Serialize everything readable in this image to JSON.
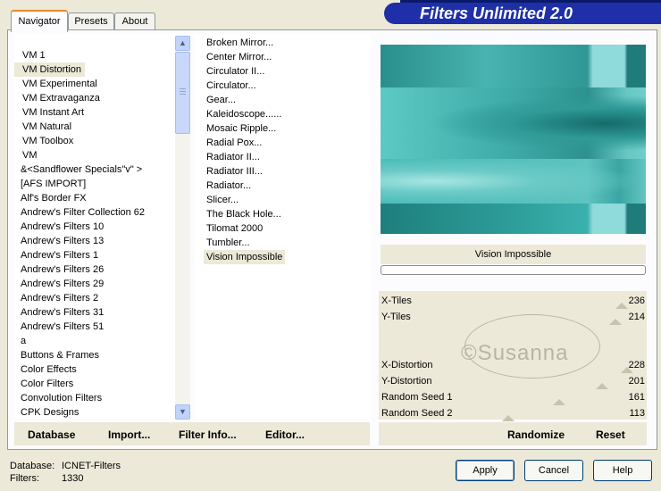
{
  "tabs": [
    "Navigator",
    "Presets",
    "About"
  ],
  "app_title": "Filters Unlimited 2.0",
  "categories": [
    "VM 1",
    "VM Distortion",
    "VM Experimental",
    "VM Extravaganza",
    "VM Instant Art",
    "VM Natural",
    "VM Toolbox",
    "VM",
    "&<Sandflower Specials\"v\" >",
    "[AFS IMPORT]",
    "Alf's Border FX",
    "Andrew's Filter Collection 62",
    "Andrew's Filters 10",
    "Andrew's Filters 13",
    "Andrew's Filters 1",
    "Andrew's Filters 26",
    "Andrew's Filters 29",
    "Andrew's Filters 2",
    "Andrew's Filters 31",
    "Andrew's Filters 51",
    "a",
    "Buttons & Frames",
    "Color Effects",
    "Color Filters",
    "Convolution Filters",
    "CPK Designs"
  ],
  "selected_category": "VM Distortion",
  "filters": [
    "Broken Mirror...",
    "Center Mirror...",
    "Circulator II...",
    "Circulator...",
    "Gear...",
    "Kaleidoscope......",
    "Mosaic Ripple...",
    "Radial Pox...",
    "Radiator II...",
    "Radiator III...",
    "Radiator...",
    "Slicer...",
    "The Black Hole...",
    "Tilomat 2000",
    "Tumbler...",
    "Vision Impossible"
  ],
  "selected_filter": "Vision Impossible",
  "nav_buttons": {
    "database": "Database",
    "import": "Import...",
    "filter_info": "Filter Info...",
    "editor": "Editor..."
  },
  "preview_title": "Vision Impossible",
  "params": [
    {
      "label": "X-Tiles",
      "value": "236"
    },
    {
      "label": "Y-Tiles",
      "value": "214"
    },
    {
      "label": "",
      "value": ""
    },
    {
      "label": "",
      "value": ""
    },
    {
      "label": "X-Distortion",
      "value": "228"
    },
    {
      "label": "Y-Distortion",
      "value": "201"
    },
    {
      "label": "Random Seed 1",
      "value": "161"
    },
    {
      "label": "Random Seed 2",
      "value": "113"
    }
  ],
  "watermark": "©Susanna",
  "randomize": "Randomize",
  "reset": "Reset",
  "status": {
    "db_label": "Database:",
    "db_value": "ICNET-Filters",
    "filters_label": "Filters:",
    "filters_value": "1330"
  },
  "dialog_buttons": {
    "apply": "Apply",
    "cancel": "Cancel",
    "help": "Help"
  },
  "colors": {
    "banner": "#1e2fa8",
    "teal_dark": "#1a7a7a",
    "teal_light": "#7fd8d8"
  }
}
